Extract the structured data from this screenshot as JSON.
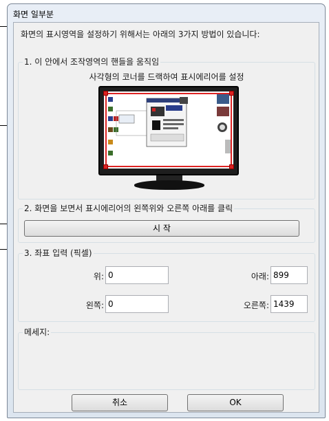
{
  "window": {
    "title": "화면 일부분"
  },
  "intro": "화면의 표시영역을 설정하기 위해서는 아래의 3가지 방법이 있습니다:",
  "section1": {
    "label": "1. 이 안에서 조작영역의 핸들을 움직임",
    "hint": "사각형의 코너를 드랙하여 표시에리어를 설정"
  },
  "section2": {
    "label": "2. 화면을 보면서 표시에리어의 왼쪽위와 오른쪽 아래를 클릭",
    "start_button": "시 작"
  },
  "section3": {
    "label": "3. 좌표 입력 (픽셀)",
    "top_label": "위:",
    "top_value": "0",
    "bottom_label": "아래:",
    "bottom_value": "899",
    "left_label": "왼쪽:",
    "left_value": "0",
    "right_label": "오른쪽:",
    "right_value": "1439"
  },
  "messages": {
    "label": "메세지:",
    "text": ""
  },
  "buttons": {
    "cancel": "취소",
    "ok": "OK"
  }
}
